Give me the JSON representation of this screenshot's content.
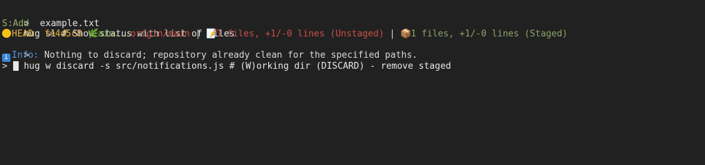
{
  "terminal": {
    "line1": {
      "prompt": ">",
      "command": "hug sl # Show status with list of files"
    },
    "line2": {
      "status": "S:Add",
      "file": "example.txt"
    },
    "line3": {
      "head_icon": "yellow-circle-icon",
      "head_label": "HEAD:",
      "commit": "fe4d5c8",
      "branch_icon": "herb-icon",
      "branch": "ain...",
      "remote": "origin/main",
      "sep1": "|",
      "unstaged_icon": "memo-icon",
      "unstaged": "1 files, +1/-0 lines (Unstaged)",
      "sep2": "|",
      "staged_icon": "package-icon",
      "staged": "1 files, +1/-0 lines (Staged)"
    },
    "line4": {
      "prompt": ">",
      "command": "hug w discard -s src/notifications.js # (W)orking dir (DISCARD) - remove staged"
    },
    "line5": {
      "info_icon": "info-icon",
      "info_label": "Info:",
      "info_text": "Nothing to discard; repository already clean for the specified paths."
    },
    "line6": {
      "prompt": ">"
    }
  },
  "colors": {
    "background": "#212121",
    "yellow": "#e3b341",
    "green": "#8bb34a",
    "red": "#d0584b",
    "info_blue": "#5a9bd5"
  }
}
